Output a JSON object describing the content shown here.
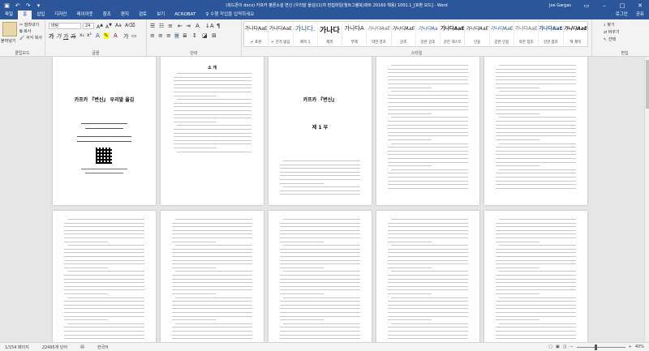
{
  "title_bar": {
    "doc_title": "(워드폰이 docx) 카프카 평론소설 변신 (우리말 옮김)(1)차 편집파일(월트그램북)파트 20160 책용) 1001.1_[호환 모드] - Word",
    "user": "Joe Gargas"
  },
  "tabs": [
    "파일",
    "홈",
    "삽입",
    "디자인",
    "레이아웃",
    "참조",
    "편지",
    "검토",
    "보기",
    "ACROBAT"
  ],
  "tell_me": "♀ 수행 작업을 입력하세요",
  "tabs_right": {
    "login": "로그인",
    "share": "공유"
  },
  "ribbon": {
    "clipboard": {
      "paste": "붙여넣기",
      "cut": "잘라내기",
      "copy": "복사",
      "format_painter": "서식 복사",
      "label": "클립보드"
    },
    "font": {
      "name": "바탕",
      "size": "24",
      "label": "글꼴"
    },
    "paragraph": {
      "label": "단락"
    },
    "styles": {
      "label": "스타일",
      "items": [
        {
          "preview": "가나다AaE",
          "name": "↵ 표준"
        },
        {
          "preview": "가나다AaE",
          "name": "↵ 간격 없음"
        },
        {
          "preview": "가나다.",
          "name": "제목 1"
        },
        {
          "preview": "가나다",
          "name": "제목"
        },
        {
          "preview": "가나다A",
          "name": "부제"
        },
        {
          "preview": "가나다AaE",
          "name": "약한 강조"
        },
        {
          "preview": "가나다AaE",
          "name": "강조"
        },
        {
          "preview": "가나다Aa",
          "name": "강한 강조"
        },
        {
          "preview": "가나다AaE",
          "name": "굵은 텍스트"
        },
        {
          "preview": "가나다AaE",
          "name": "인용"
        },
        {
          "preview": "가나다AaE",
          "name": "강한 인용"
        },
        {
          "preview": "가나다AaE",
          "name": "약한 참조"
        },
        {
          "preview": "가나다AaE",
          "name": "강한 참조"
        },
        {
          "preview": "가나다AaE",
          "name": "책 제목"
        }
      ]
    },
    "editing": {
      "find": "찾기",
      "replace": "바꾸기",
      "select": "선택",
      "label": "편집"
    }
  },
  "pages_row1": [
    {
      "title": "카프카 『변신』 우리말 옮김",
      "lines": "cover"
    },
    {
      "title": "소 개",
      "lines": "intro"
    },
    {
      "title": "카프카 『변신』",
      "subtitle": "제 1 부",
      "lines": "part"
    },
    {
      "title": "",
      "lines": "text"
    },
    {
      "title": "",
      "lines": "text"
    }
  ],
  "pages_row2": [
    {
      "lines": "text"
    },
    {
      "lines": "text"
    },
    {
      "lines": "text"
    },
    {
      "lines": "text"
    },
    {
      "lines": "text"
    }
  ],
  "status": {
    "page": "1/154 페이지",
    "words": "22495개 단어",
    "lang": "한국어",
    "zoom": "40%"
  }
}
